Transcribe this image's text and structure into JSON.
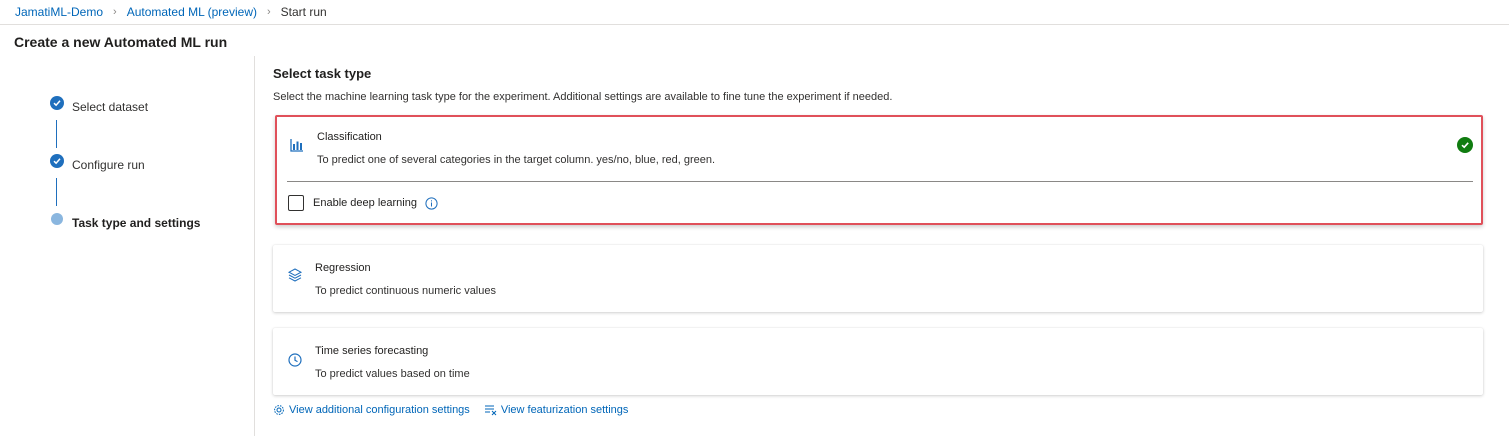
{
  "breadcrumb": {
    "items": [
      "JamatiML-Demo",
      "Automated ML (preview)"
    ],
    "current": "Start run"
  },
  "page": {
    "title": "Create a new Automated ML run"
  },
  "steps": [
    {
      "label": "Select dataset",
      "status": "completed"
    },
    {
      "label": "Configure run",
      "status": "completed"
    },
    {
      "label": "Task type and settings",
      "status": "current"
    }
  ],
  "task": {
    "title": "Select task type",
    "description": "Select the machine learning task type for the experiment. Additional settings are available to fine tune the experiment if needed.",
    "options": [
      {
        "icon": "bar-chart-icon",
        "title": "Classification",
        "description": "To predict one of several categories in the target column. yes/no, blue, red, green.",
        "selected": true
      },
      {
        "icon": "layers-icon",
        "title": "Regression",
        "description": "To predict continuous numeric values",
        "selected": false
      },
      {
        "icon": "clock-icon",
        "title": "Time series forecasting",
        "description": "To predict values based on time",
        "selected": false
      }
    ],
    "deep_learning": {
      "label": "Enable deep learning",
      "checked": false
    }
  },
  "links": {
    "additional_config": "View additional configuration settings",
    "featurization": "View featurization settings"
  },
  "colors": {
    "accent": "#0066b8",
    "step": "#1f6fbd",
    "selected_border": "#e0505a",
    "success": "#107c10"
  }
}
